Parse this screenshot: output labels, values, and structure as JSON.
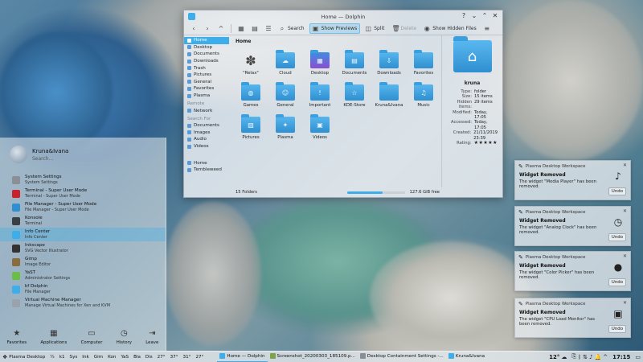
{
  "dolphin": {
    "title": "Home — Dolphin",
    "toolbar": {
      "back": "‹",
      "forward": "›",
      "up": "^",
      "search": "Search",
      "show_previews": "Show Previews",
      "split": "Split",
      "delete": "Delete",
      "show_hidden": "Show Hidden Files",
      "menu": "≡"
    },
    "sidebar": {
      "places_items": [
        "Home",
        "Desktop",
        "Documents",
        "Downloads",
        "Trash",
        "Pictures",
        "General",
        "Favorites",
        "Plasma"
      ],
      "remote_label": "Remote",
      "remote_items": [
        "Network"
      ],
      "search_label": "Search For",
      "search_items": [
        "Documents",
        "Images",
        "Audio",
        "Videos"
      ],
      "devices_items": [
        "Home",
        "Tembleweed"
      ]
    },
    "breadcrumb": "Home",
    "files": [
      {
        "name": "\"Relax\"",
        "glyph": "✽",
        "kind": "leaf"
      },
      {
        "name": "Cloud",
        "glyph": "☁",
        "kind": "folder"
      },
      {
        "name": "Desktop",
        "glyph": "▦",
        "kind": "special"
      },
      {
        "name": "Documents",
        "glyph": "▤",
        "kind": "folder"
      },
      {
        "name": "Downloads",
        "glyph": "⇩",
        "kind": "folder"
      },
      {
        "name": "Favorites",
        "glyph": "",
        "kind": "folder"
      },
      {
        "name": "Games",
        "glyph": "◍",
        "kind": "folder"
      },
      {
        "name": "General",
        "glyph": "☺",
        "kind": "folder"
      },
      {
        "name": "Important",
        "glyph": "!",
        "kind": "folder"
      },
      {
        "name": "KDE-Store",
        "glyph": "☆",
        "kind": "folder"
      },
      {
        "name": "Kruna&Ivana",
        "glyph": "",
        "kind": "folder"
      },
      {
        "name": "Music",
        "glyph": "♫",
        "kind": "folder"
      },
      {
        "name": "Pictures",
        "glyph": "▧",
        "kind": "folder"
      },
      {
        "name": "Plasma",
        "glyph": "✦",
        "kind": "folder"
      },
      {
        "name": "Videos",
        "glyph": "▣",
        "kind": "folder"
      }
    ],
    "info": {
      "title": "kruna",
      "rows": [
        {
          "k": "Type:",
          "v": "folder"
        },
        {
          "k": "Size:",
          "v": "15 items"
        },
        {
          "k": "Hidden items:",
          "v": "29 items"
        },
        {
          "k": "Modified:",
          "v": "Today, 17:05"
        },
        {
          "k": "Accessed:",
          "v": "Today, 17:05"
        },
        {
          "k": "Created:",
          "v": "21/11/2019 23:39"
        }
      ],
      "rating_label": "Rating:",
      "rating_stars": "★★★★★"
    },
    "status": {
      "folders": "15 Folders",
      "free": "127.6 GiB free",
      "free_fraction": 0.62
    }
  },
  "kickoff": {
    "user": "Kruna&Ivana",
    "search_placeholder": "Search...",
    "items": [
      {
        "title": "System Settings",
        "subtitle": "System Settings",
        "color": "#8a8f96"
      },
      {
        "title": "Terminal - Super User Mode",
        "subtitle": "Terminal - Super User Mode",
        "color": "#c8232c"
      },
      {
        "title": "File Manager - Super User Mode",
        "subtitle": "File Manager - Super User Mode",
        "color": "#2f8fd0"
      },
      {
        "title": "Konsole",
        "subtitle": "Terminal",
        "color": "#3a3f44"
      },
      {
        "title": "Info Center",
        "subtitle": "Info Center",
        "color": "#3daee9"
      },
      {
        "title": "Inkscape",
        "subtitle": "SVG Vector Illustrator",
        "color": "#333333"
      },
      {
        "title": "Gimp",
        "subtitle": "Image Editor",
        "color": "#8a6d3b"
      },
      {
        "title": "YaST",
        "subtitle": "Administrator Settings",
        "color": "#6bbe45"
      },
      {
        "title": "kf Dolphin",
        "subtitle": "File Manager",
        "color": "#3daee9"
      },
      {
        "title": "Virtual Machine Manager",
        "subtitle": "Manage Virtual Machines for Xen and KVM",
        "color": "#9aa3ab"
      }
    ],
    "tabs": [
      {
        "label": "Favorites",
        "glyph": "★"
      },
      {
        "label": "Applications",
        "glyph": "▦"
      },
      {
        "label": "Computer",
        "glyph": "▭"
      },
      {
        "label": "History",
        "glyph": "◷"
      },
      {
        "label": "Leave",
        "glyph": "⇥"
      }
    ]
  },
  "notifications": [
    {
      "source": "Plasma Desktop Workspace",
      "title": "Widget Removed",
      "body": "The widget \"Media Player\" has been removed.",
      "undo": "Undo",
      "thumb_glyph": "♪"
    },
    {
      "source": "Plasma Desktop Workspace",
      "title": "Widget Removed",
      "body": "The widget \"Analog Clock\" has been removed.",
      "undo": "Undo",
      "thumb_glyph": "◷"
    },
    {
      "source": "Plasma Desktop Workspace",
      "title": "Widget Removed",
      "body": "The widget \"Color Picker\" has been removed.",
      "undo": "Undo",
      "thumb_glyph": "●"
    },
    {
      "source": "Plasma Desktop Workspace",
      "title": "Widget Removed",
      "body": "The widget \"CPU Load Monitor\" has been removed.",
      "undo": "Undo",
      "thumb_glyph": "▣"
    }
  ],
  "panel": {
    "menu_label": "Plasma Desktop",
    "pager": [
      "¼",
      "k1"
    ],
    "quick": [
      "Sys",
      "Ink",
      "Gim",
      "Kon",
      "YaS",
      "Bla",
      "Dis"
    ],
    "temps": [
      "27°",
      "37°",
      "31°",
      "27°"
    ],
    "tasks": [
      "Home — Dolphin",
      "Screenshot_20200303_185109.p...",
      "Desktop Containment Settings -...",
      "Kruna&Ivana"
    ],
    "weather": "12°",
    "clock": "17:15"
  }
}
